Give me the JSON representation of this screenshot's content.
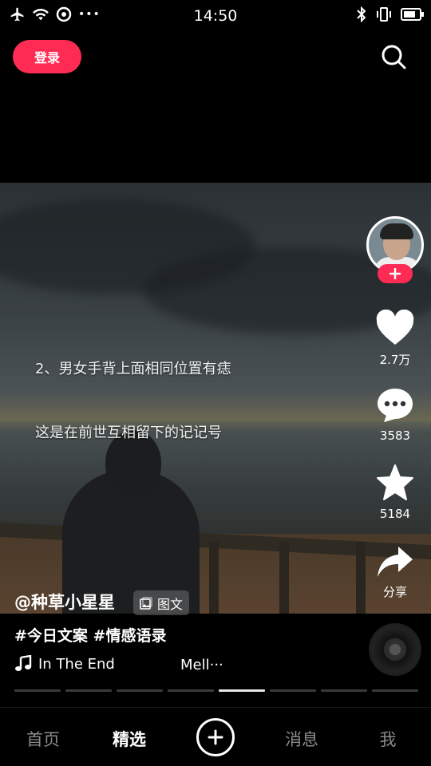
{
  "status_bar": {
    "time": "14:50",
    "left_icons": [
      "airplane-icon",
      "wifi-icon",
      "sync-icon",
      "more-dots-icon"
    ],
    "more_dots": "•••",
    "right_icons": [
      "bluetooth-icon",
      "vibrate-icon",
      "battery-icon"
    ]
  },
  "header": {
    "login_label": "登录",
    "search_icon": "search-icon"
  },
  "video": {
    "overlay_lines": [
      "2、男女手背上面相同位置有痣",
      "这是在前世互相留下的记记号"
    ],
    "accent_color": "#fe2c55"
  },
  "actions": {
    "likes": "2.7万",
    "comments": "3583",
    "favorites": "5184",
    "share": "分享"
  },
  "post": {
    "author": "@种草小星星",
    "type_tag": "图文",
    "description": "#今日文案 #情感语录",
    "music_title": "In The End",
    "music_artist": "Mell···"
  },
  "progress": {
    "total_segments": 8,
    "active_segment": 5
  },
  "nav": {
    "home": "首页",
    "featured": "精选",
    "messages": "消息",
    "me": "我"
  }
}
